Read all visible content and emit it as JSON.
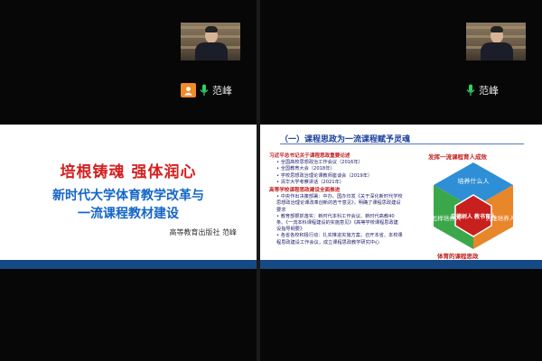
{
  "participants": [
    {
      "name": "范峰"
    },
    {
      "name": "范峰"
    }
  ],
  "slide_title": {
    "line1": "培根铸魂  强体润心",
    "line2": "新时代大学体育教学改革与",
    "line3": "一流课程教材建设",
    "publisher": "高等教育出版社  范峰"
  },
  "slide_content": {
    "section_title": "（一）课程思政为一流课程赋予灵魂",
    "items": [
      {
        "kind": "h",
        "text": "习近平总书记关于课程思政重要论述"
      },
      {
        "kind": "s",
        "text": "• 全国高校思想政治工作会议（2016年）"
      },
      {
        "kind": "s",
        "text": "• 全国教育大会（2018年）"
      },
      {
        "kind": "s",
        "text": "• 学校思想政治理论课教师座谈会（2019年）"
      },
      {
        "kind": "s",
        "text": "• 清华大学考察讲话（2021年）"
      },
      {
        "kind": "h",
        "text": "高等学校课程思政建设全面推进"
      },
      {
        "kind": "p",
        "text": "• 中央作出决策部署：中办、国办印发《关于深化新时代学校思想政治理论课改革创新的若干意见》，明确了课程思政建设要求"
      },
      {
        "kind": "p",
        "text": "• 教育部狠抓落实：新时代本科工作会议、新时代高教40条、《一流本科课程建设的实施意见》《高等学校课程思政建设指导纲要》"
      },
      {
        "kind": "p",
        "text": "• 各省各校积极行动：扎实推进实施方案，召开本省、本校课程思政建设工作会议，成立课程思政教学研究中心"
      }
    ],
    "diagram_title": "发挥一流课程育人成效",
    "diagram": {
      "top": "培养什么人",
      "left": "怎样培养人",
      "right": "为谁培养人",
      "center": "立德树人 教书育人"
    },
    "diagram_caption": "体育的课程思政"
  },
  "colors": {
    "title_red": "#d42020",
    "title_blue": "#1466c8",
    "hex_blue": "#2e8fd6",
    "hex_green": "#3aa84a",
    "hex_orange": "#e8862a",
    "center_red": "#c8201e"
  }
}
